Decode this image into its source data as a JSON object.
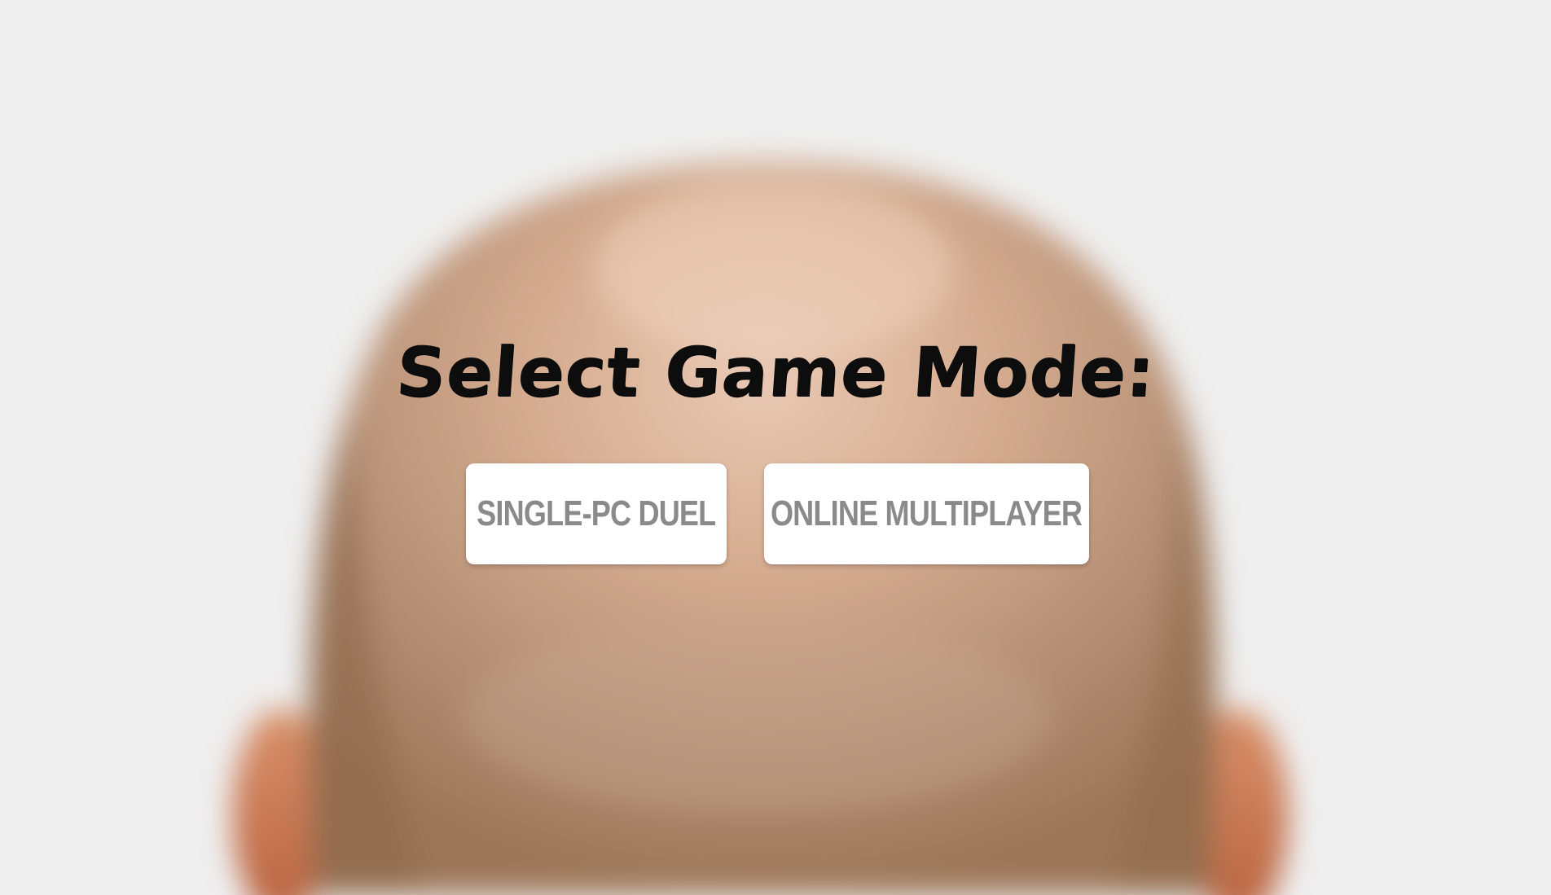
{
  "background": {
    "description_icon": "blurred-bald-head-background",
    "backdrop_color": "#efefef",
    "head_color": "#c49a7a",
    "ear_color": "#c97a55"
  },
  "menu": {
    "title": "Select Game Mode:",
    "buttons": [
      {
        "label": "SINGLE-PC DUEL"
      },
      {
        "label": "ONLINE MULTIPLAYER"
      }
    ]
  },
  "colors": {
    "title": "#0d0d0d",
    "button_bg": "#ffffff",
    "button_text": "#8a8a8a"
  }
}
